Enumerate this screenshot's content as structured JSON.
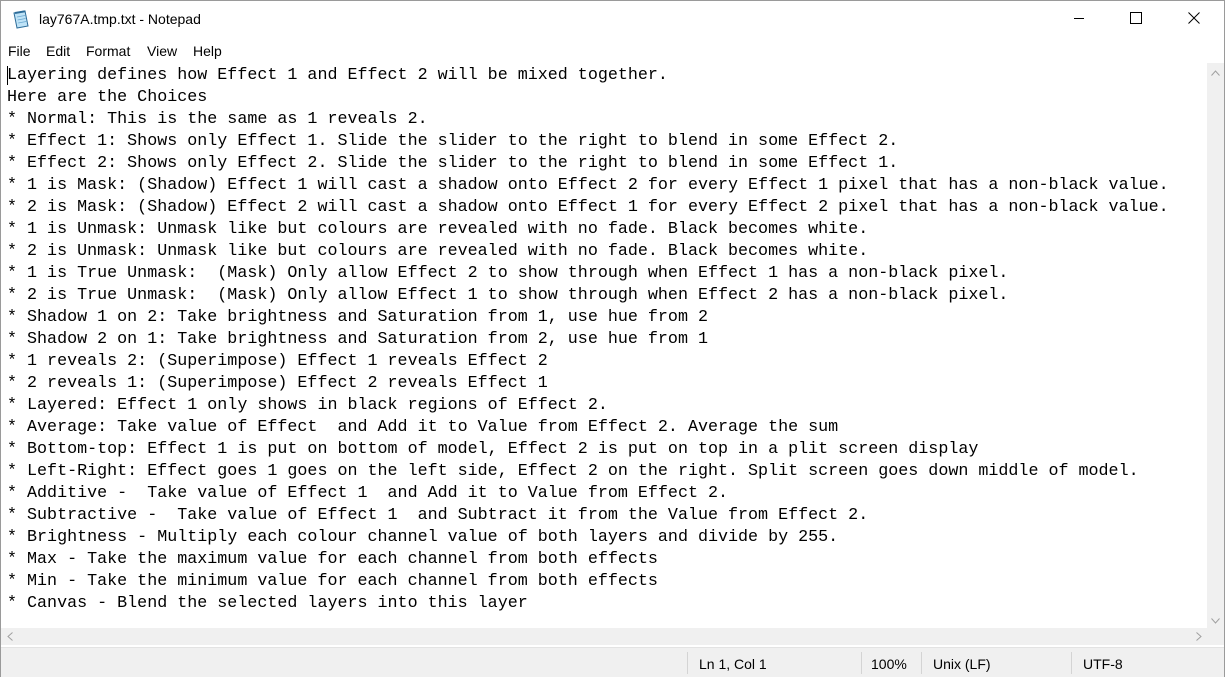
{
  "window": {
    "title": "lay767A.tmp.txt - Notepad",
    "icon": "notepad-icon",
    "controls": [
      "minimize-icon",
      "maximize-icon",
      "close-icon"
    ]
  },
  "menu": {
    "items": [
      "File",
      "Edit",
      "Format",
      "View",
      "Help"
    ]
  },
  "editor": {
    "lines": [
      "Layering defines how Effect 1 and Effect 2 will be mixed together.",
      "Here are the Choices",
      "* Normal: This is the same as 1 reveals 2.",
      "* Effect 1: Shows only Effect 1. Slide the slider to the right to blend in some Effect 2.",
      "* Effect 2: Shows only Effect 2. Slide the slider to the right to blend in some Effect 1.",
      "* 1 is Mask: (Shadow) Effect 1 will cast a shadow onto Effect 2 for every Effect 1 pixel that has a non-black value.",
      "* 2 is Mask: (Shadow) Effect 2 will cast a shadow onto Effect 1 for every Effect 2 pixel that has a non-black value.",
      "* 1 is Unmask: Unmask like but colours are revealed with no fade. Black becomes white.",
      "* 2 is Unmask: Unmask like but colours are revealed with no fade. Black becomes white.",
      "* 1 is True Unmask:  (Mask) Only allow Effect 2 to show through when Effect 1 has a non-black pixel.",
      "* 2 is True Unmask:  (Mask) Only allow Effect 1 to show through when Effect 2 has a non-black pixel.",
      "* Shadow 1 on 2: Take brightness and Saturation from 1, use hue from 2",
      "* Shadow 2 on 1: Take brightness and Saturation from 2, use hue from 1",
      "* 1 reveals 2: (Superimpose) Effect 1 reveals Effect 2",
      "* 2 reveals 1: (Superimpose) Effect 2 reveals Effect 1",
      "* Layered: Effect 1 only shows in black regions of Effect 2.",
      "* Average: Take value of Effect  and Add it to Value from Effect 2. Average the sum",
      "* Bottom-top: Effect 1 is put on bottom of model, Effect 2 is put on top in a plit screen display",
      "* Left-Right: Effect goes 1 goes on the left side, Effect 2 on the right. Split screen goes down middle of model.",
      "* Additive -  Take value of Effect 1  and Add it to Value from Effect 2.",
      "* Subtractive -  Take value of Effect 1  and Subtract it from the Value from Effect 2.",
      "* Brightness - Multiply each colour channel value of both layers and divide by 255.",
      "* Max - Take the maximum value for each channel from both effects",
      "* Min - Take the minimum value for each channel from both effects",
      "* Canvas - Blend the selected layers into this layer"
    ]
  },
  "status": {
    "position": "Ln 1, Col 1",
    "zoom": "100%",
    "line_ending": "Unix (LF)",
    "encoding": "UTF-8"
  },
  "colors": {
    "chrome": "#f0f0f0",
    "text": "#000000",
    "background": "#ffffff"
  }
}
